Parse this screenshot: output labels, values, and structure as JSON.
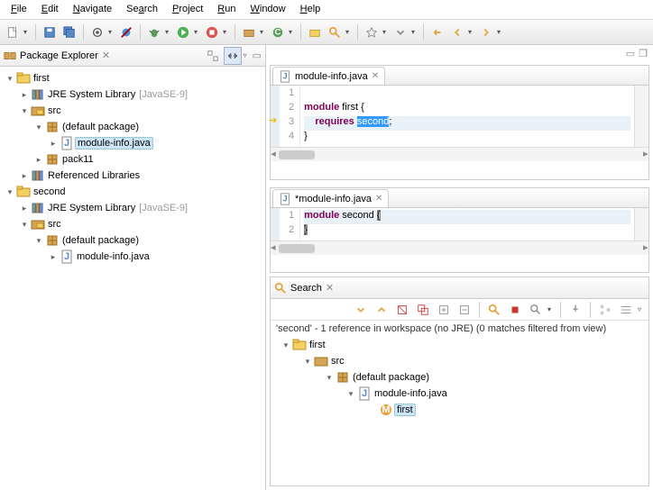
{
  "menu": {
    "file": "File",
    "edit": "Edit",
    "navigate": "Navigate",
    "search": "Search",
    "project": "Project",
    "run": "Run",
    "window": "Window",
    "help": "Help"
  },
  "explorer": {
    "title": "Package Explorer",
    "projects": [
      {
        "name": "first",
        "jre_label": "JRE System Library",
        "jre_decor": "[JavaSE-9]",
        "src": "src",
        "default_pkg": "(default package)",
        "module_info": "module-info.java",
        "extra_pkg": "pack11",
        "ref_libs": "Referenced Libraries"
      },
      {
        "name": "second",
        "jre_label": "JRE System Library",
        "jre_decor": "[JavaSE-9]",
        "src": "src",
        "default_pkg": "(default package)",
        "module_info": "module-info.java"
      }
    ]
  },
  "editor1": {
    "tab": "module-info.java",
    "lines": [
      "1",
      "2",
      "3",
      "4"
    ],
    "code": {
      "l1": "",
      "l2": "module first {",
      "l3a": "    requires ",
      "l3b": "second",
      "l3c": ";",
      "l4": "}"
    }
  },
  "editor2": {
    "tab": "*module-info.java",
    "lines": [
      "1",
      "2"
    ],
    "code": {
      "l1a": "module second ",
      "l1b": "{",
      "l2": "}"
    }
  },
  "search": {
    "title": "Search",
    "message": "'second' - 1 reference in workspace (no JRE) (0 matches filtered from view)",
    "tree": {
      "proj": "first",
      "src": "src",
      "pkg": "(default package)",
      "file": "module-info.java",
      "match": "first"
    }
  }
}
